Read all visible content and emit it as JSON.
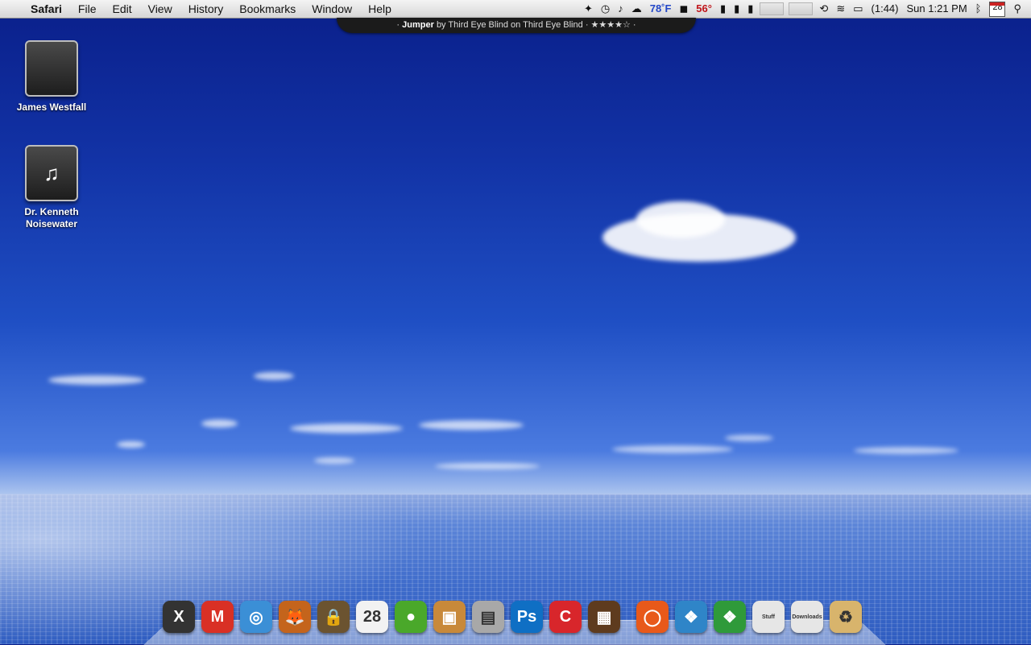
{
  "menubar": {
    "app_name": "Safari",
    "menus": [
      "File",
      "Edit",
      "View",
      "History",
      "Bookmarks",
      "Window",
      "Help"
    ],
    "status": {
      "weather_temp": "78˚F",
      "cpu_temp": "56°",
      "battery_time": "(1:44)",
      "clock": "Sun 1:21 PM",
      "calendar_day": "28"
    }
  },
  "now_playing": {
    "song": "Jumper",
    "artist_text": "by Third Eye Blind on Third Eye Blind",
    "rating_stars": "★★★★☆"
  },
  "desktop_icons": [
    {
      "label": "James Westfall",
      "icon": "apple-drive-icon"
    },
    {
      "label": "Dr. Kenneth Noisewater",
      "icon": "music-drive-icon"
    }
  ],
  "dock": {
    "items": [
      {
        "name": "crossover-icon",
        "glyph": "X",
        "color": "#333333"
      },
      {
        "name": "gmail-icon",
        "glyph": "M",
        "color": "#d93025"
      },
      {
        "name": "safari-icon",
        "glyph": "◎",
        "color": "#3b8fd6"
      },
      {
        "name": "firefox-icon",
        "glyph": "🦊",
        "color": "#c4641c"
      },
      {
        "name": "padlock-icon",
        "glyph": "🔒",
        "color": "#6b5330"
      },
      {
        "name": "ical-icon",
        "glyph": "28",
        "color": "#f2f2f2"
      },
      {
        "name": "adium-duck-icon",
        "glyph": "●",
        "color": "#4aa82a"
      },
      {
        "name": "iphoto-icon",
        "glyph": "▣",
        "color": "#c8893a"
      },
      {
        "name": "utility-icon",
        "glyph": "▤",
        "color": "#a8a8a8"
      },
      {
        "name": "photoshop-icon",
        "glyph": "Ps",
        "color": "#0f6fc4"
      },
      {
        "name": "cornerstone-icon",
        "glyph": "C",
        "color": "#d8262b"
      },
      {
        "name": "bookcase-icon",
        "glyph": "▦",
        "color": "#5e3b1e"
      },
      {
        "name": "ubuntu-icon",
        "glyph": "◯",
        "color": "#e8591a"
      },
      {
        "name": "windows-vista-icon",
        "glyph": "❖",
        "color": "#2f85c8"
      },
      {
        "name": "windows-xp-icon",
        "glyph": "❖",
        "color": "#2f9a3a"
      },
      {
        "name": "stuff-folder-icon",
        "glyph": "Stuff",
        "color": "#e6e6e6"
      },
      {
        "name": "downloads-folder-icon",
        "glyph": "Downloads",
        "color": "#e6e6e6"
      },
      {
        "name": "trash-icon",
        "glyph": "♻",
        "color": "#d8b46c"
      }
    ]
  }
}
